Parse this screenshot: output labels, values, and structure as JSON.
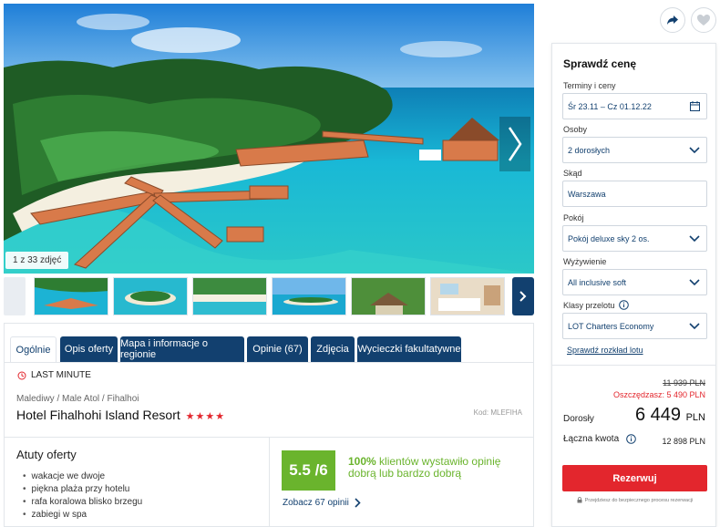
{
  "gallery": {
    "counter": "1 z 33 zdjęć",
    "thumb_count": 6
  },
  "tabs": [
    {
      "label": "Ogólnie",
      "active": true
    },
    {
      "label": "Opis oferty"
    },
    {
      "label": "Mapa i informacje o regionie"
    },
    {
      "label": "Opinie (67)"
    },
    {
      "label": "Zdjęcia"
    },
    {
      "label": "Wycieczki fakultatywne"
    }
  ],
  "offer": {
    "badge": "LAST MINUTE",
    "breadcrumb": "Malediwy / Male Atol / Fihalhoi",
    "hotel_name": "Hotel Fihalhohi Island Resort",
    "stars": "★★★★",
    "star_rating": 4,
    "code": "Kod: MLEFIHA"
  },
  "highlights": {
    "title": "Atuty oferty",
    "items": [
      "wakacje we dwoje",
      "piękna plaża przy hotelu",
      "rafa koralowa blisko brzegu",
      "zabiegi w spa"
    ]
  },
  "rating": {
    "score": "5.5 /6",
    "percent": "100%",
    "text": " klientów wystawiło opinię dobrą lub bardzo dobrą",
    "see_link": "Zobacz 67 opinii"
  },
  "panel": {
    "title": "Sprawdź cenę",
    "fields": {
      "dates": {
        "label": "Terminy i ceny",
        "value": "Śr 23.11 – Cz 01.12.22"
      },
      "people": {
        "label": "Osoby",
        "value": "2 dorosłych"
      },
      "from": {
        "label": "Skąd",
        "value": "Warszawa"
      },
      "room": {
        "label": "Pokój",
        "value": "Pokój deluxe sky 2 os."
      },
      "board": {
        "label": "Wyżywienie",
        "value": "All inclusive soft"
      },
      "flight": {
        "label": "Klasy przelotu",
        "value": "LOT Charters Economy"
      }
    },
    "schedule_link": "Sprawdź rozkład lotu",
    "old_price": "11 939 PLN",
    "savings": "Oszczędzasz: 5 490 PLN",
    "adults_label": "Dorosły",
    "price": "6 449",
    "currency": "PLN",
    "total_label": "Łączna kwota",
    "total_value": "12 898 PLN",
    "reserve_label": "Rezerwuj",
    "secure_note": "Przejdziesz do bezpiecznego procesu rezerwacji"
  },
  "colors": {
    "navy": "#12406f",
    "red": "#e3262d",
    "green": "#6ab42d"
  }
}
